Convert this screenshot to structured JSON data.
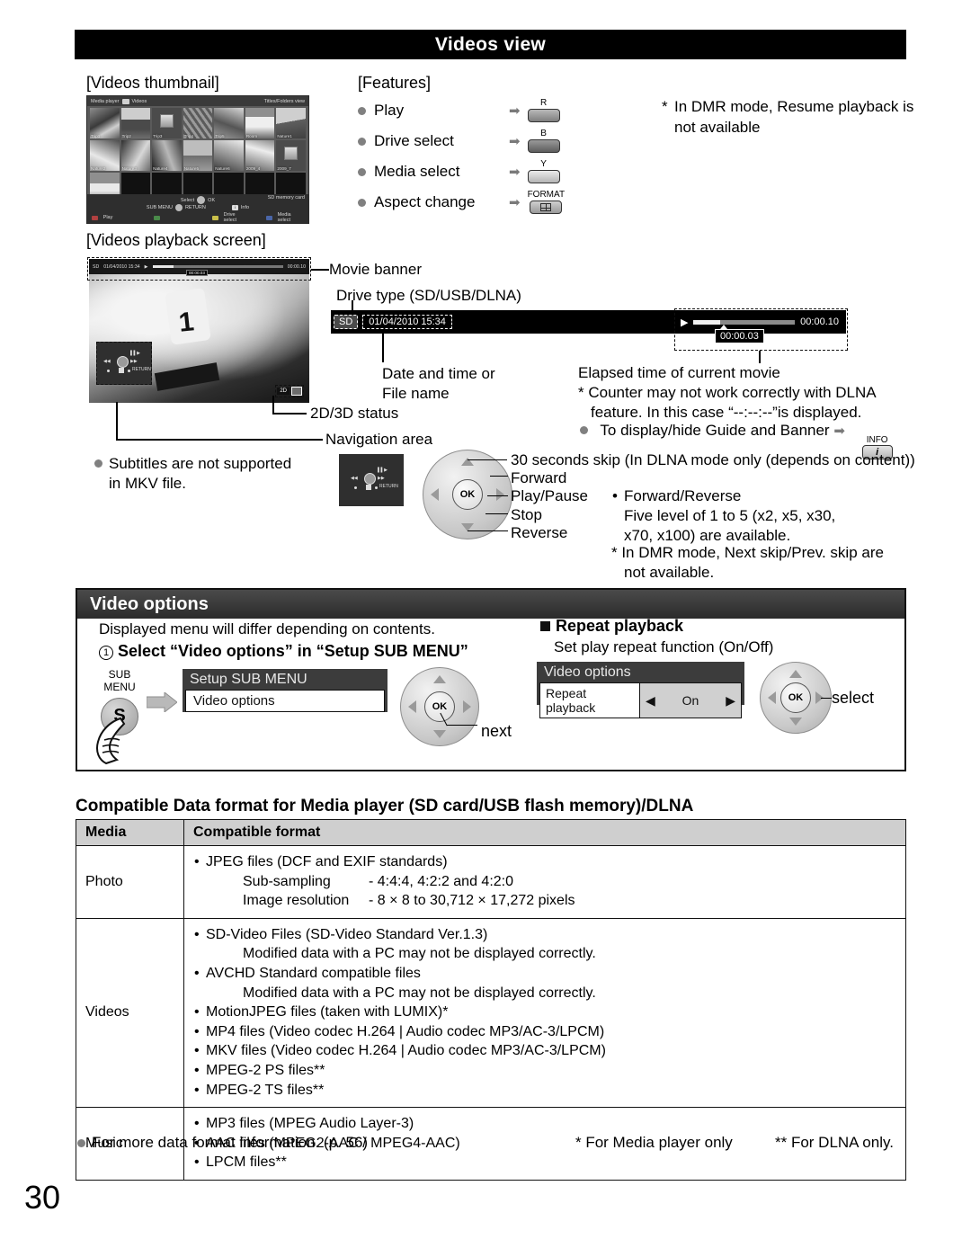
{
  "page": {
    "title": "Videos view",
    "number": "30"
  },
  "thumbnail_section": {
    "caption": "[Videos thumbnail]",
    "tv": {
      "breadcrumb_app": "Media player",
      "breadcrumb_section": "Videos",
      "view_mode": "Titles/Folders view",
      "items": [
        "Trip1",
        "Trip2",
        "Trip3",
        "Trip4",
        "Trip5",
        "Room",
        "Nature1",
        "Nature2",
        "Nature3",
        "Nature4",
        "Nature5",
        "Nature6",
        "2009_4",
        "2009_7",
        "2009_9"
      ],
      "selected_item": "Trip1",
      "guide": {
        "select": "Select",
        "ok": "OK",
        "submenu": "SUB MENU",
        "return": "RETURN",
        "play": "Play",
        "info": "Info",
        "drive_select": "Drive select",
        "media_select": "Media select",
        "storage": "SD memory card"
      }
    }
  },
  "features_section": {
    "caption": "[Features]",
    "rows": [
      {
        "label": "Play",
        "key_top": "R",
        "key_kind": "r"
      },
      {
        "label": "Drive select",
        "key_top": "B",
        "key_kind": "b"
      },
      {
        "label": "Media select",
        "key_top": "Y",
        "key_kind": "y"
      },
      {
        "label": "Aspect change",
        "key_top": "FORMAT",
        "key_kind": "fmt"
      }
    ],
    "note": "* In DMR mode, Resume playback is not available",
    "note_star": "*",
    "note_text": "In DMR mode, Resume playback is not available"
  },
  "playback_section": {
    "caption": "[Videos playback screen]",
    "screen": {
      "banner_drive": "SD",
      "banner_datetime": "01/04/2010  15:34",
      "banner_total": "00:00.10",
      "banner_counter": "00:00.03",
      "status_2d": "2D",
      "nav_return": "RETURN"
    },
    "callouts": {
      "movie_banner": "Movie banner",
      "drive_type": "Drive type (SD/USB/DLNA)",
      "date_time_l1": "Date and time or",
      "date_time_l2": "File name",
      "status_2d3d": "2D/3D status",
      "navigation_area": "Navigation area",
      "elapsed_title": "Elapsed time of current movie",
      "elapsed_note_l1": "* Counter may not work correctly with DLNA",
      "elapsed_note_l2": "feature. In this case “--:--:--”is displayed.",
      "guide_banner": "To display/hide Guide and Banner",
      "guide_banner_key_top": "INFO",
      "guide_banner_key_label": "i"
    },
    "subtitle_note_l1": "Subtitles are not supported",
    "subtitle_note_l2": "in MKV file."
  },
  "remote_section": {
    "labels": [
      "30 seconds skip (In DLNA mode only (depends on content))",
      "Forward",
      "Play/Pause",
      "Stop",
      "Reverse"
    ],
    "ok_label": "OK",
    "notes": {
      "fwd_rev_title": "Forward/Reverse",
      "fwd_rev_l1": "Five level of 1 to 5 (x2, x5, x30,",
      "fwd_rev_l2": "x70, x100) are available.",
      "dmr_l1": "* In DMR mode, Next skip/Prev. skip are",
      "dmr_l2": "not available."
    }
  },
  "video_options": {
    "header": "Video options",
    "intro": "Displayed menu will differ depending on contents.",
    "step_number": "1",
    "step_text": "Select “Video options” in “Setup SUB MENU”",
    "submenu_key_l1": "SUB",
    "submenu_key_l2": "MENU",
    "submenu_key_glyph": "S",
    "menu_panel": {
      "title": "Setup SUB MENU",
      "item": "Video options"
    },
    "next_label": "next",
    "ok_label": "OK",
    "repeat": {
      "title": "Repeat playback",
      "desc": "Set play repeat function (On/Off)",
      "panel_title": "Video options",
      "row_key": "Repeat playback",
      "row_value": "On",
      "select_label": "select",
      "ok_label": "OK"
    }
  },
  "format_table": {
    "title": "Compatible Data format for Media player (SD card/USB flash memory)/DLNA",
    "headers": [
      "Media",
      "Compatible format"
    ],
    "rows": [
      {
        "media": "Photo",
        "bullets": [
          "JPEG files (DCF and EXIF standards)"
        ],
        "subs": [
          {
            "key": "Sub-sampling",
            "value": "- 4:4:4, 4:2:2 and 4:2:0"
          },
          {
            "key": "Image resolution",
            "value": "- 8 × 8 to 30,712 × 17,272 pixels"
          }
        ]
      },
      {
        "media": "Videos",
        "lines": [
          {
            "type": "bullet",
            "text": "SD-Video Files (SD-Video Standard Ver.1.3)"
          },
          {
            "type": "sub",
            "text": "Modified data with a PC may not be displayed correctly."
          },
          {
            "type": "bullet",
            "text": "AVCHD Standard compatible files"
          },
          {
            "type": "sub",
            "text": "Modified data with a PC may not be displayed correctly."
          },
          {
            "type": "bullet",
            "text": "MotionJPEG files (taken with LUMIX)*"
          },
          {
            "type": "bullet",
            "text": "MP4 files (Video codec H.264 | Audio codec MP3/AC-3/LPCM)"
          },
          {
            "type": "bullet",
            "text": "MKV files (Video codec H.264 | Audio codec MP3/AC-3/LPCM)"
          },
          {
            "type": "bullet",
            "text": "MPEG-2 PS files**"
          },
          {
            "type": "bullet",
            "text": "MPEG-2 TS files**"
          }
        ]
      },
      {
        "media": "Music",
        "lines": [
          {
            "type": "bullet",
            "text": "MP3 files (MPEG Audio Layer-3)"
          },
          {
            "type": "bullet",
            "text": "AAC files (MPEG2-AAC / MPEG4-AAC)"
          },
          {
            "type": "bullet",
            "text": "LPCM files**"
          }
        ]
      }
    ],
    "footer_bullet": "For more data format information. (p. 56)",
    "footer_note_star": "* For Media player only",
    "footer_note_dstar": "** For DLNA only."
  }
}
